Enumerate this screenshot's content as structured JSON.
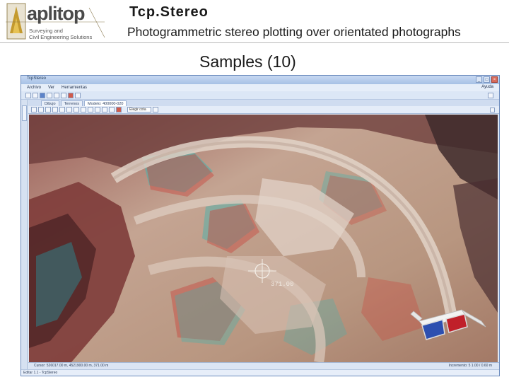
{
  "header": {
    "logo_text": "aplitop",
    "logo_sub1": "Surveying and",
    "logo_sub2": "Civil Engineering Solutions",
    "title": "Tcp.Stereo",
    "subtitle": "Photogrammetric stereo plotting over orientated photographs",
    "section": "Samples (10)"
  },
  "window": {
    "title": "TcpStereo",
    "controls": [
      "_",
      "□",
      "×"
    ],
    "menus": [
      "Archivo",
      "Ver",
      "Herramientas"
    ],
    "help": "Ayuda",
    "tabs": [
      "Dibujo",
      "Terrenos",
      "Modelo: 400000-020"
    ],
    "dropdown_value": "Elegir cota"
  },
  "viewer": {
    "cursor_label": "371.00"
  },
  "status": {
    "left": "Cursor: 526017.00 m, 4521900.00 m, 371.00 m",
    "right": "Incremento: 5 1.00 / 0.60 m",
    "bottom": "Editar 1.1 - TcpStereo"
  },
  "colors": {
    "title_blue": "#a7c1e6",
    "anaglyph_red": "#c8473d",
    "anaglyph_cyan": "#3fb4b0",
    "glasses_lens_red": "#c0202a",
    "glasses_lens_blue": "#2d4fb0"
  },
  "icons": {
    "logo": "aplitop-logo",
    "glasses": "3d-glasses-icon",
    "cursor": "crosshair-icon"
  }
}
